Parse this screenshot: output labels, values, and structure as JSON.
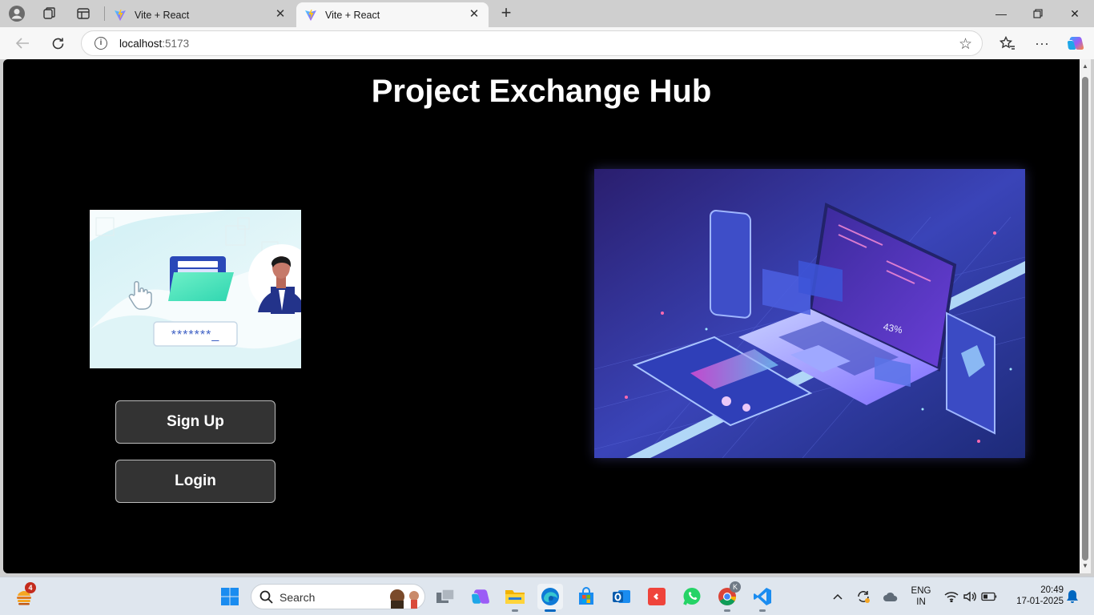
{
  "browser": {
    "tabs": [
      {
        "title": "Vite + React",
        "active": false
      },
      {
        "title": "Vite + React",
        "active": true
      }
    ],
    "address": {
      "host": "localhost",
      "port": ":5173"
    }
  },
  "page": {
    "title": "Project Exchange Hub",
    "buttons": {
      "signup": "Sign Up",
      "login": "Login"
    },
    "login_illustration": {
      "password_mask": "*******_"
    },
    "tech_illustration": {
      "percent_label": "43%"
    }
  },
  "taskbar": {
    "search_placeholder": "Search",
    "widget_badge": "4",
    "language": {
      "line1": "ENG",
      "line2": "IN"
    },
    "clock": {
      "time": "20:49",
      "date": "17-01-2025"
    },
    "chrome_profile_badge": "K"
  },
  "colors": {
    "page_bg": "#000000",
    "button_bg": "#333333",
    "accent": "#0067c0"
  }
}
